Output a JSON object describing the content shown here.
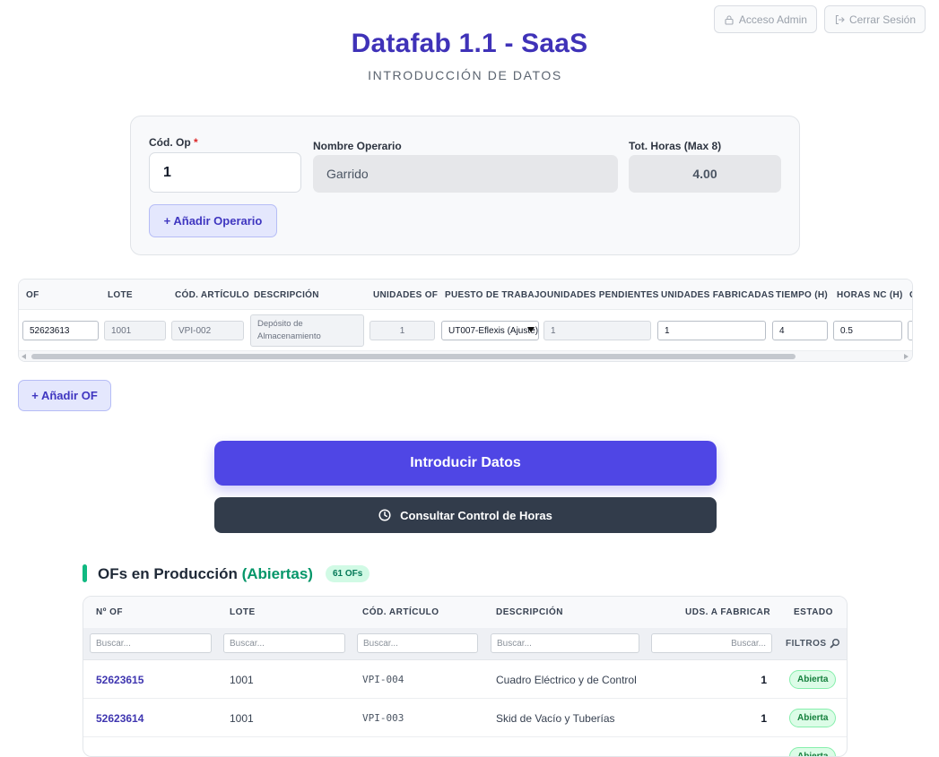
{
  "header": {
    "admin_label": "Acceso Admin",
    "logout_label": "Cerrar Sesión",
    "title": "Datafab 1.1 - SaaS",
    "subtitle": "INTRODUCCIÓN DE DATOS"
  },
  "operator": {
    "code_label": "Cód. Op",
    "code_required": "*",
    "code_value": "1",
    "name_label": "Nombre Operario",
    "name_value": "Garrido",
    "hours_label": "Tot. Horas (Max 8)",
    "hours_value": "4.00",
    "add_label": "+ Añadir Operario"
  },
  "of_table": {
    "headers": [
      "OF",
      "LOTE",
      "CÓD. ARTÍCULO",
      "DESCRIPCIÓN",
      "UNIDADES OF",
      "PUESTO DE TRABAJO",
      "UNIDADES PENDIENTES",
      "UNIDADES FABRICADAS",
      "TIEMPO (H)",
      "HORAS NC (H)",
      "C"
    ],
    "row": {
      "of": "52623613",
      "lote": "1001",
      "articulo": "VPI-002",
      "descripcion": "Depósito de Almacenamiento",
      "unidades_of": "1",
      "puesto": "UT007-Eflexis (Ajuste)",
      "pendientes": "1",
      "fabricadas": "1",
      "tiempo": "4",
      "horas_nc": "0.5"
    }
  },
  "add_of_label": "+ Añadir OF",
  "submit_label": "Introducir Datos",
  "hours_control_label": "Consultar Control de Horas",
  "production": {
    "title_main": "OFs en Producción",
    "title_accent": "(Abiertas)",
    "count_badge": "61 OFs",
    "headers": [
      "Nº OF",
      "LOTE",
      "CÓD. ARTÍCULO",
      "DESCRIPCIÓN",
      "UDS. A FABRICAR",
      "ESTADO"
    ],
    "search_placeholder": "Buscar...",
    "filters_label": "FILTROS",
    "rows": [
      {
        "of": "52623615",
        "lote": "1001",
        "articulo": "VPI-004",
        "descripcion": "Cuadro Eléctrico y de Control",
        "uds": "1",
        "estado": "Abierta"
      },
      {
        "of": "52623614",
        "lote": "1001",
        "articulo": "VPI-003",
        "descripcion": "Skid de Vacío y Tuberías",
        "uds": "1",
        "estado": "Abierta"
      },
      {
        "of": "",
        "lote": "",
        "articulo": "",
        "descripcion": "",
        "uds": "",
        "estado": "Abierta"
      }
    ]
  },
  "colors": {
    "brand": "#3f32b8",
    "primary_button": "#4f46e5",
    "dark_button": "#323c4b",
    "status_open": "#15803d",
    "accent_green": "#059669"
  }
}
